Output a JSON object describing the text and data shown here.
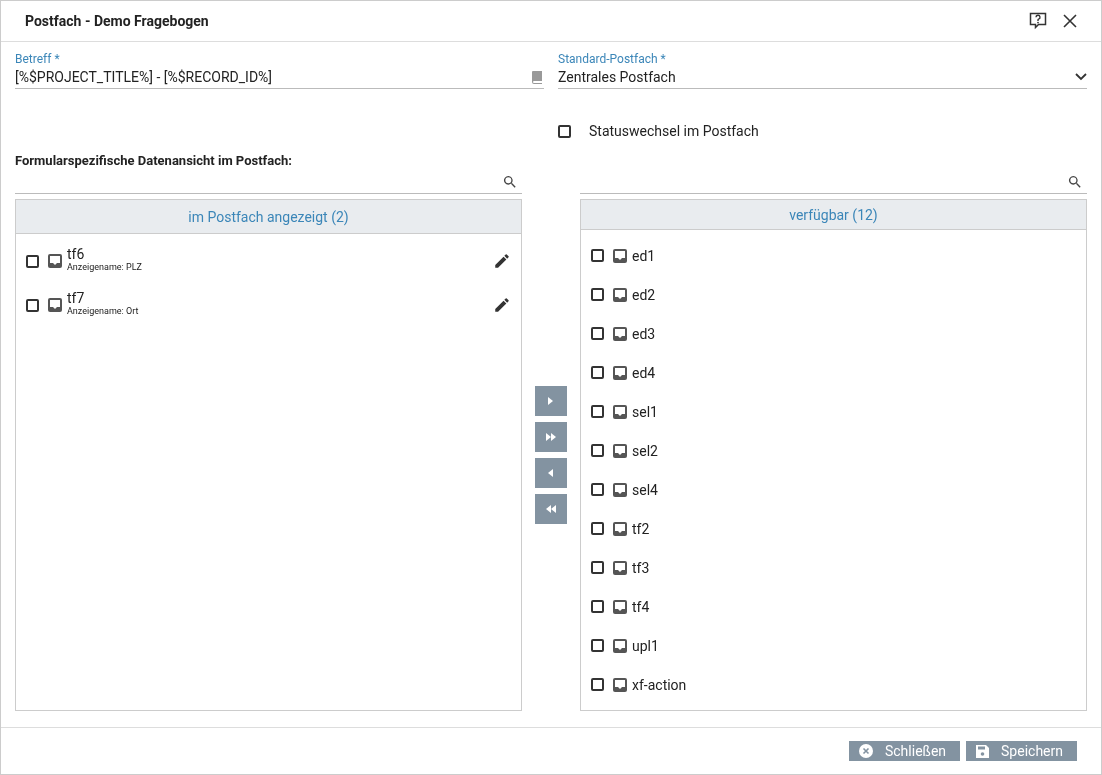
{
  "window": {
    "title": "Postfach - Demo Fragebogen"
  },
  "subject": {
    "label": "Betreff *",
    "value": "[%$PROJECT_TITLE%] - [%$RECORD_ID%]"
  },
  "mailbox": {
    "label": "Standard-Postfach *",
    "value": "Zentrales Postfach"
  },
  "status_change": {
    "label": "Statuswechsel im Postfach",
    "checked": false
  },
  "section_title": "Formularspezifische Datenansicht im Postfach:",
  "shown_list": {
    "header": "im Postfach angezeigt (2)",
    "items": [
      {
        "name": "tf6",
        "display_name": "Anzeigename: PLZ",
        "checked": false
      },
      {
        "name": "tf7",
        "display_name": "Anzeigename: Ort",
        "checked": false
      }
    ]
  },
  "move_buttons": [
    {
      "kind": "move-right"
    },
    {
      "kind": "move-all-right"
    },
    {
      "kind": "move-left"
    },
    {
      "kind": "move-all-left"
    }
  ],
  "available_list": {
    "header": "verfügbar (12)",
    "items": [
      {
        "name": "ed1",
        "checked": false
      },
      {
        "name": "ed2",
        "checked": false
      },
      {
        "name": "ed3",
        "checked": false
      },
      {
        "name": "ed4",
        "checked": false
      },
      {
        "name": "sel1",
        "checked": false
      },
      {
        "name": "sel2",
        "checked": false
      },
      {
        "name": "sel4",
        "checked": false
      },
      {
        "name": "tf2",
        "checked": false
      },
      {
        "name": "tf3",
        "checked": false
      },
      {
        "name": "tf4",
        "checked": false
      },
      {
        "name": "upl1",
        "checked": false
      },
      {
        "name": "xf-action",
        "checked": false
      }
    ]
  },
  "footer_buttons": [
    {
      "kind": "close",
      "label": "Schließen"
    },
    {
      "kind": "save",
      "label": "Speichern"
    }
  ]
}
